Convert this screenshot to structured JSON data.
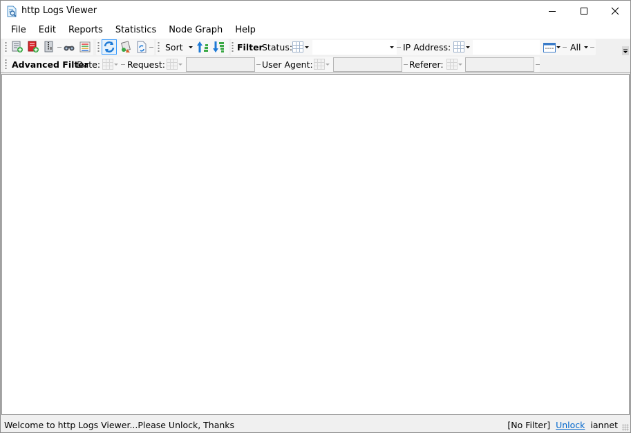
{
  "window": {
    "title": "http Logs Viewer",
    "controls": {
      "minimize": "minimize-icon",
      "maximize": "maximize-icon",
      "close": "close-icon"
    }
  },
  "menu": [
    "File",
    "Edit",
    "Reports",
    "Statistics",
    "Node Graph",
    "Help"
  ],
  "toolbar": {
    "buttons": [
      {
        "name": "add-log-file",
        "icon": "add-file-icon"
      },
      {
        "name": "add-log-file-red",
        "icon": "add-red-file-icon"
      },
      {
        "name": "log-archive",
        "icon": "zip-file-icon"
      },
      {
        "name": "find",
        "icon": "binoculars-icon"
      },
      {
        "name": "columns",
        "icon": "columns-list-icon"
      },
      {
        "name": "refresh",
        "icon": "refresh-icon",
        "active": true
      },
      {
        "name": "clear-logs",
        "icon": "cleanup-icon"
      },
      {
        "name": "reload-file",
        "icon": "reload-file-icon"
      }
    ],
    "sort_label": "Sort",
    "sort_ascending_icon": "sort-ascending-icon",
    "sort_descending_icon": "sort-descending-icon",
    "filter_label": "Filter",
    "status_label": "Status:",
    "status_value": "",
    "ip_label": "IP Address:",
    "ip_value": "",
    "range_value": "All"
  },
  "advanced_filter": {
    "label": "Advanced Filter",
    "date_label": "Date:",
    "request_label": "Request:",
    "request_value": "",
    "user_agent_label": "User Agent:",
    "user_agent_value": "",
    "referer_label": "Referer:",
    "referer_value": ""
  },
  "status": {
    "message": "Welcome to http Logs Viewer...Please Unlock, Thanks",
    "filter": "[No Filter]",
    "unlock_link": "Unlock",
    "user": "iannet"
  },
  "colors": {
    "accent": "#3399ff",
    "link": "#0066cc",
    "chrome": "#f0f0f0"
  }
}
